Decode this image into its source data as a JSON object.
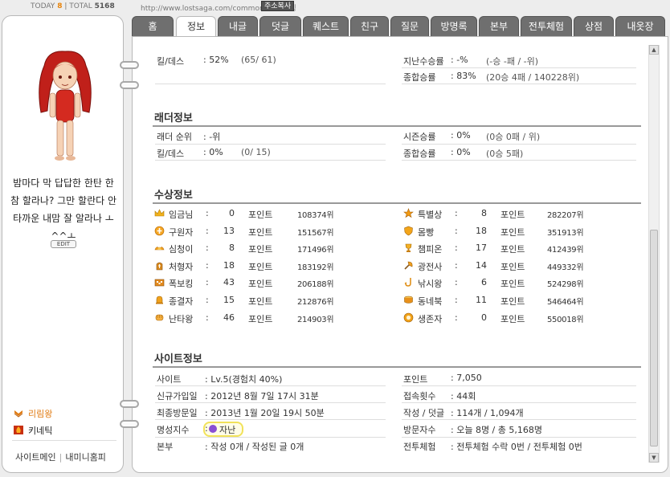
{
  "top": {
    "today_label": "TODAY",
    "today_value": "8",
    "total_label": "| TOTAL",
    "total_value": "5168",
    "url": "http://www.lostsaga.com/common/?id=링링",
    "copy_label": "주소복사"
  },
  "left": {
    "message": "밤마다 막 답답한 한탄 한참 할라나? 그만 할란다 안타까운 내맘 잘 알라나 ㅗ ^^ㅗ",
    "edit_label": "EDIT",
    "link1": "리림왕",
    "link2": "키네틱",
    "bottom_link1": "사이트메인",
    "bottom_link2": "내미니홈피"
  },
  "tabs": [
    "홈",
    "정보",
    "내글",
    "덧글",
    "퀘스트",
    "친구",
    "질문",
    "방명록",
    "본부",
    "전투체험",
    "상점",
    "내옷장"
  ],
  "active_tab": "정보",
  "battle": {
    "killdeath_label": "킬/데스",
    "killdeath_value": ": 52%",
    "killdeath_sub": "(65/ 61)",
    "lastseason_label": "지난수승률",
    "lastseason_value": ": -%",
    "lastseason_sub": "(-승 -패 / -위)",
    "total_label": "종합승률",
    "total_value": ": 83%",
    "total_sub": "(20승 4패 / 140228위)"
  },
  "ladder": {
    "title": "래더정보",
    "rank_label": "래더 순위",
    "rank_value": ": -위",
    "season_label": "시즌승률",
    "season_value": ": 0%",
    "season_sub": "(0승 0패 / 위)",
    "killdeath_label": "킬/데스",
    "killdeath_value": ": 0%",
    "killdeath_sub": "(0/ 15)",
    "total_label": "종합승률",
    "total_value": ": 0%",
    "total_sub": "(0승 5패)"
  },
  "awards": {
    "title": "수상정보",
    "points_unit": "포인트",
    "left": [
      {
        "name": "임금님",
        "points": "0",
        "rank": "108374위",
        "icon": "crown-icon"
      },
      {
        "name": "구원자",
        "points": "13",
        "rank": "151567위",
        "icon": "cross-shield-icon"
      },
      {
        "name": "심청이",
        "points": "8",
        "rank": "171496위",
        "icon": "lotus-icon"
      },
      {
        "name": "처형자",
        "points": "18",
        "rank": "183192위",
        "icon": "tombstone-icon"
      },
      {
        "name": "폭보킹",
        "points": "43",
        "rank": "206188위",
        "icon": "bomb-icon"
      },
      {
        "name": "종결자",
        "points": "15",
        "rank": "212876위",
        "icon": "bell-icon"
      },
      {
        "name": "난타왕",
        "points": "46",
        "rank": "214903위",
        "icon": "fist-icon"
      }
    ],
    "right": [
      {
        "name": "특별상",
        "points": "8",
        "rank": "282207위",
        "icon": "star-icon"
      },
      {
        "name": "몸빵",
        "points": "18",
        "rank": "351913위",
        "icon": "shield-icon"
      },
      {
        "name": "챔피온",
        "points": "17",
        "rank": "412439위",
        "icon": "trophy-icon"
      },
      {
        "name": "광전사",
        "points": "14",
        "rank": "449332위",
        "icon": "axe-icon"
      },
      {
        "name": "낚시왕",
        "points": "6",
        "rank": "524298위",
        "icon": "fishing-hook-icon"
      },
      {
        "name": "동네북",
        "points": "11",
        "rank": "546464위",
        "icon": "drum-icon"
      },
      {
        "name": "생존자",
        "points": "0",
        "rank": "550018위",
        "icon": "survivor-badge-icon"
      }
    ]
  },
  "site": {
    "title": "사이트정보",
    "site_label": "사이트",
    "site_value": ": Lv.5(경험치 40%)",
    "points_label": "포인트",
    "points_value": ": 7,050",
    "join_label": "신규가입일",
    "join_value": ": 2012년 8월 7일 17시 31분",
    "visits_label": "접속횟수",
    "visits_value": ": 44회",
    "last_label": "최종방문일",
    "last_value": ": 2013년 1월 20일 19시 50분",
    "posts_label": "작성 / 덧글",
    "posts_value": ": 114개 / 1,094개",
    "fame_label": "명성지수",
    "fame_colon": ":",
    "fame_value": "자난",
    "visitors_label": "방문자수",
    "visitors_value": ": 오늘 8명 / 총 5,168명",
    "hq_label": "본부",
    "hq_value": ": 작성 0개 / 작성된 글 0개",
    "battle_exp_label": "전투체험",
    "battle_exp_value": ": 전투체험 수락 0번 / 전투체험 0번"
  }
}
